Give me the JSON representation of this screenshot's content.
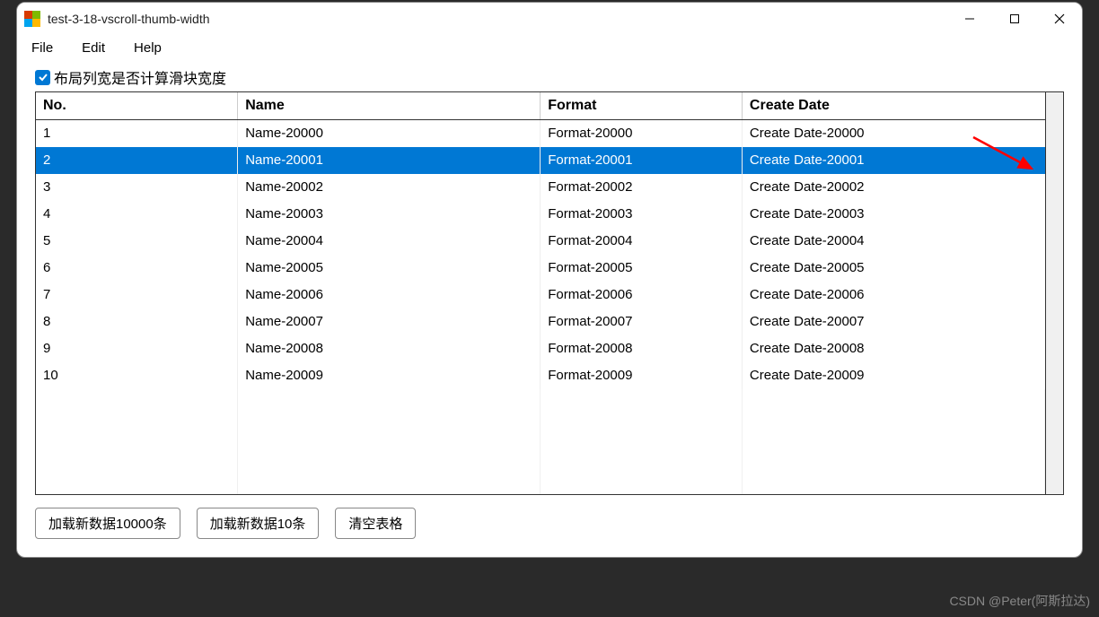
{
  "window": {
    "title": "test-3-18-vscroll-thumb-width"
  },
  "menu": {
    "file": "File",
    "edit": "Edit",
    "help": "Help"
  },
  "checkbox": {
    "label": "布局列宽是否计算滑块宽度",
    "checked": true
  },
  "table": {
    "columns": [
      "No.",
      "Name",
      "Format",
      "Create Date"
    ],
    "rows": [
      {
        "no": "1",
        "name": "Name-20000",
        "format": "Format-20000",
        "create": "Create Date-20000",
        "selected": false
      },
      {
        "no": "2",
        "name": "Name-20001",
        "format": "Format-20001",
        "create": "Create Date-20001",
        "selected": true
      },
      {
        "no": "3",
        "name": "Name-20002",
        "format": "Format-20002",
        "create": "Create Date-20002",
        "selected": false
      },
      {
        "no": "4",
        "name": "Name-20003",
        "format": "Format-20003",
        "create": "Create Date-20003",
        "selected": false
      },
      {
        "no": "5",
        "name": "Name-20004",
        "format": "Format-20004",
        "create": "Create Date-20004",
        "selected": false
      },
      {
        "no": "6",
        "name": "Name-20005",
        "format": "Format-20005",
        "create": "Create Date-20005",
        "selected": false
      },
      {
        "no": "7",
        "name": "Name-20006",
        "format": "Format-20006",
        "create": "Create Date-20006",
        "selected": false
      },
      {
        "no": "8",
        "name": "Name-20007",
        "format": "Format-20007",
        "create": "Create Date-20007",
        "selected": false
      },
      {
        "no": "9",
        "name": "Name-20008",
        "format": "Format-20008",
        "create": "Create Date-20008",
        "selected": false
      },
      {
        "no": "10",
        "name": "Name-20009",
        "format": "Format-20009",
        "create": "Create Date-20009",
        "selected": false
      }
    ],
    "empty_rows": 4
  },
  "buttons": {
    "load10000": "加载新数据10000条",
    "load10": "加载新数据10条",
    "clear": "清空表格"
  },
  "watermark": "CSDN @Peter(阿斯拉达)"
}
